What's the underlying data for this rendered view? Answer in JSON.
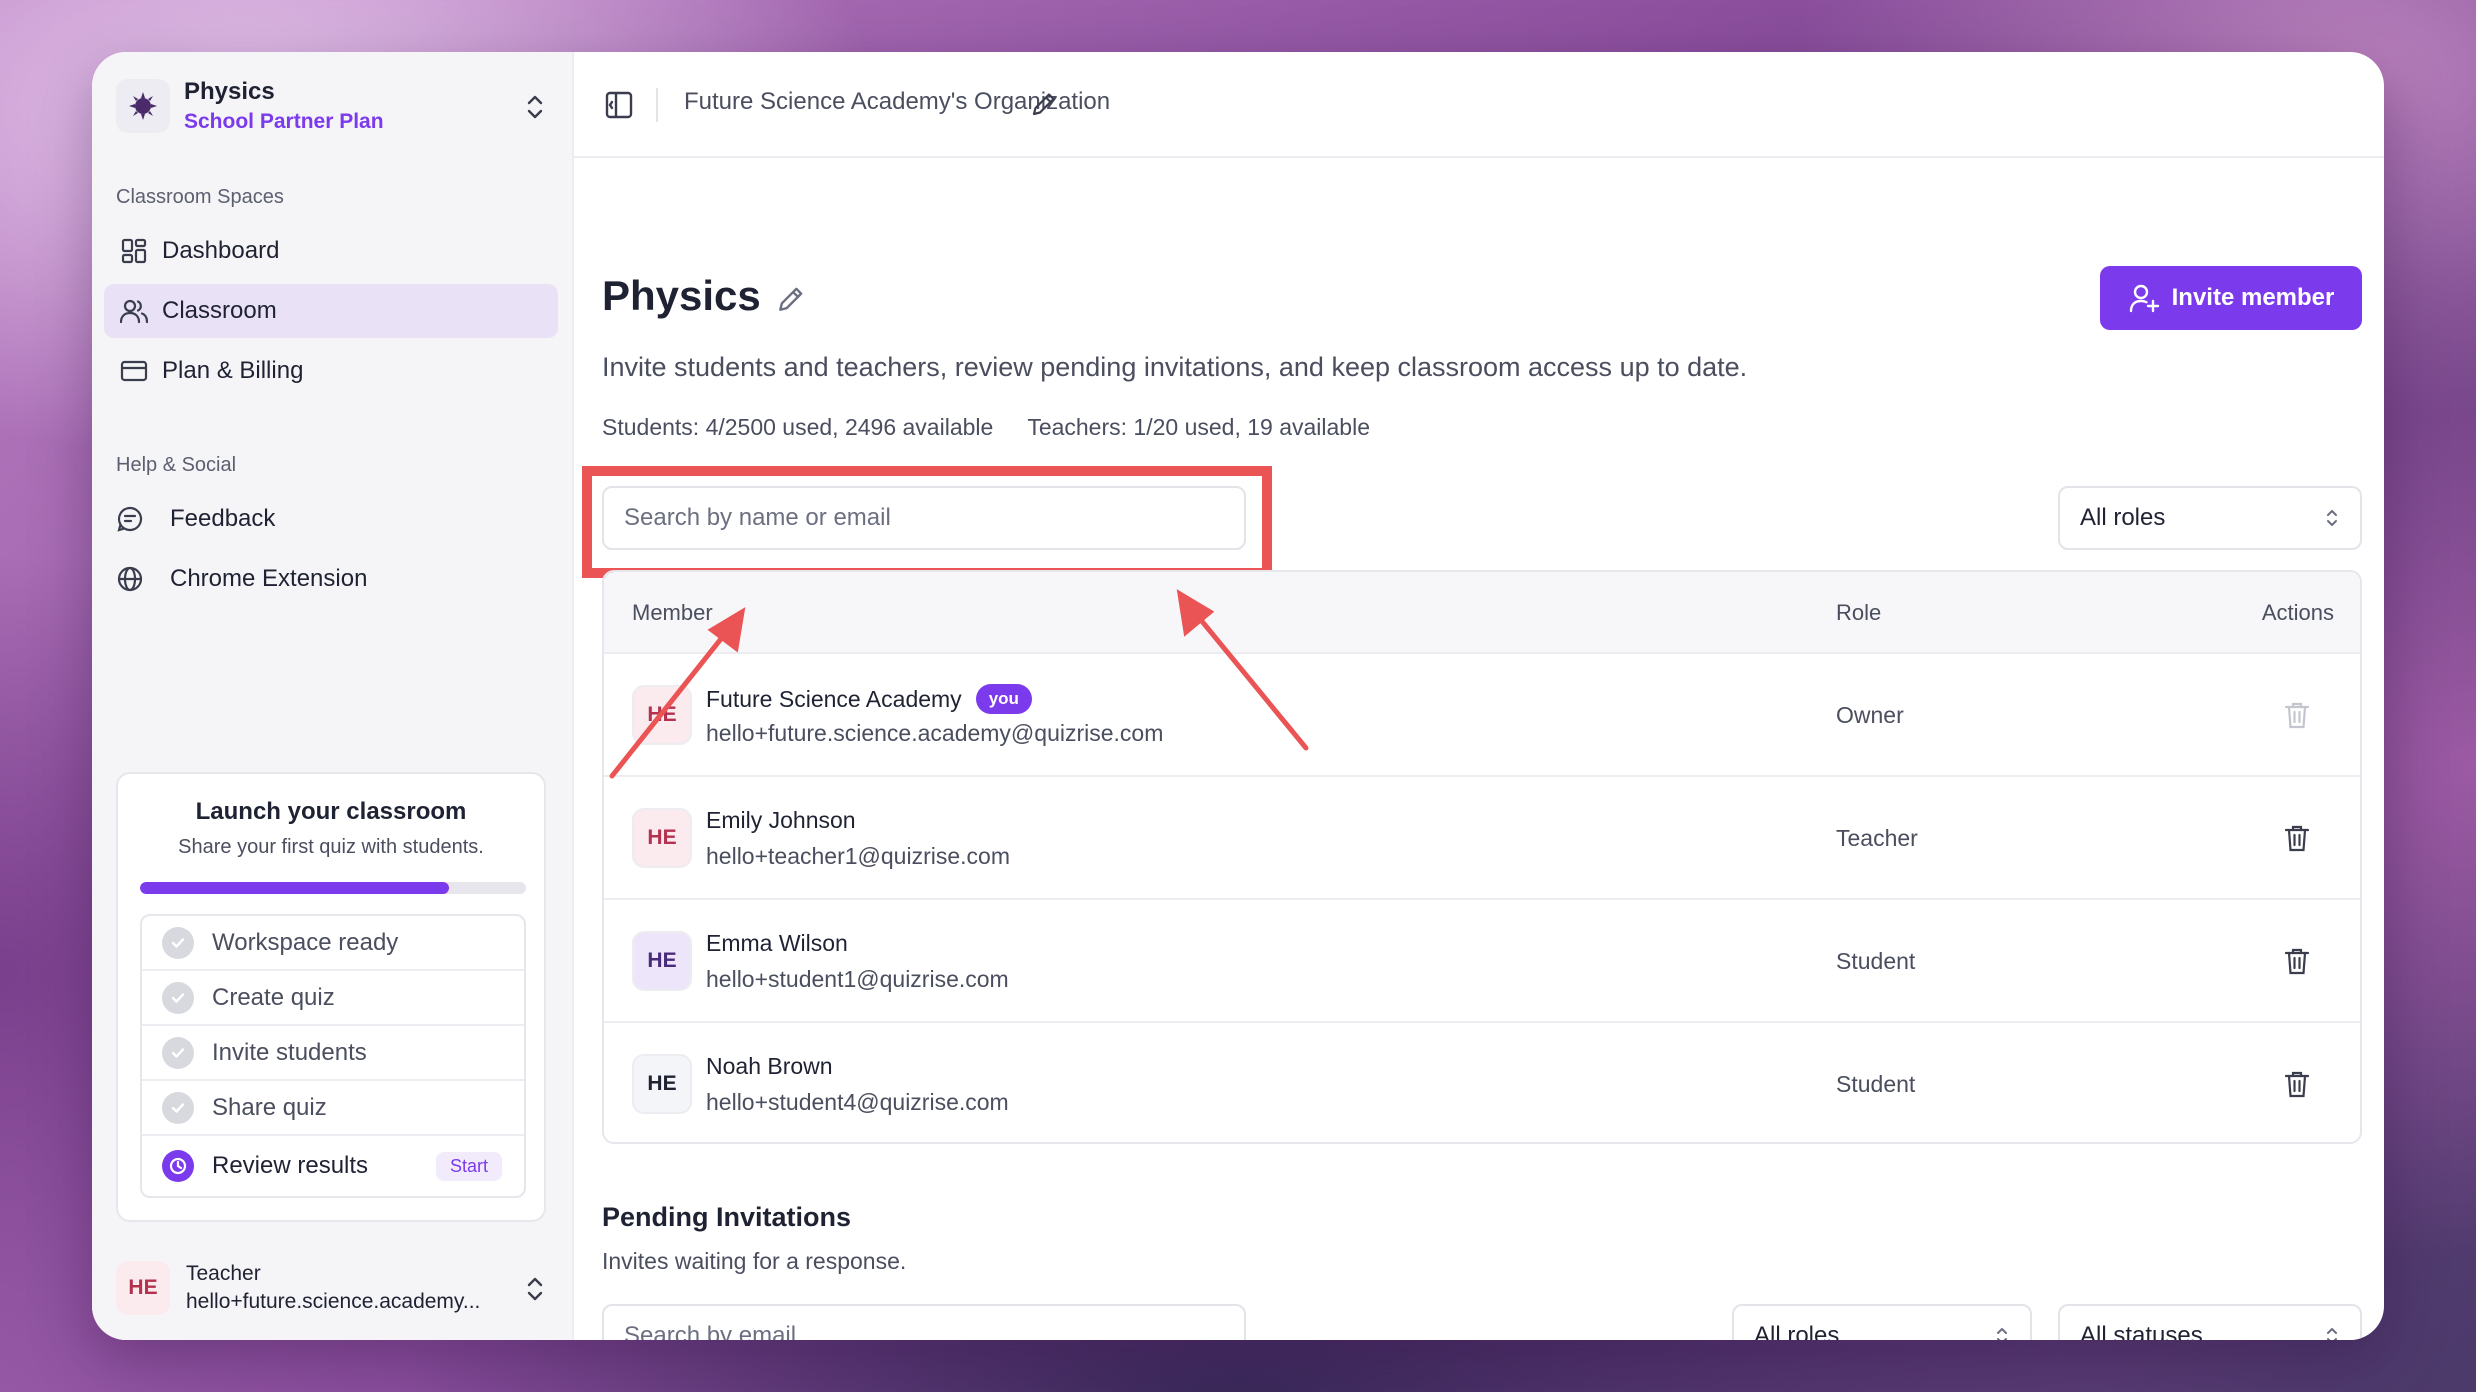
{
  "org": {
    "name": "Physics",
    "plan": "School Partner Plan"
  },
  "sidebar": {
    "section_classroom": "Classroom Spaces",
    "items": [
      {
        "label": "Dashboard"
      },
      {
        "label": "Classroom"
      },
      {
        "label": "Plan & Billing"
      }
    ],
    "section_help": "Help & Social",
    "help_items": [
      {
        "label": "Feedback"
      },
      {
        "label": "Chrome Extension"
      }
    ]
  },
  "launch": {
    "title": "Launch your classroom",
    "subtitle": "Share your first quiz with students.",
    "progress": 0.8,
    "steps": [
      {
        "label": "Workspace ready"
      },
      {
        "label": "Create quiz"
      },
      {
        "label": "Invite students"
      },
      {
        "label": "Share quiz"
      },
      {
        "label": "Review results",
        "action": "Start"
      }
    ]
  },
  "user": {
    "initials": "HE",
    "role": "Teacher",
    "email": "hello+future.science.academy..."
  },
  "topbar": {
    "org_title": "Future Science Academy's Organization"
  },
  "page": {
    "title": "Physics",
    "invite_label": "Invite member",
    "description": "Invite students and teachers, review pending invitations, and keep classroom access up to date.",
    "students_quota": "Students: 4/2500 used, 2496 available",
    "teachers_quota": "Teachers: 1/20 used, 19 available",
    "search_placeholder": "Search by name or email",
    "role_filter": "All roles"
  },
  "table": {
    "headers": {
      "member": "Member",
      "role": "Role",
      "actions": "Actions"
    },
    "rows": [
      {
        "initials": "HE",
        "name": "Future Science Academy",
        "badge": "you",
        "email": "hello+future.science.academy@quizrise.com",
        "role": "Owner"
      },
      {
        "initials": "HE",
        "name": "Emily Johnson",
        "email": "hello+teacher1@quizrise.com",
        "role": "Teacher"
      },
      {
        "initials": "HE",
        "name": "Emma Wilson",
        "email": "hello+student1@quizrise.com",
        "role": "Student"
      },
      {
        "initials": "HE",
        "name": "Noah Brown",
        "email": "hello+student4@quizrise.com",
        "role": "Student"
      }
    ]
  },
  "pending": {
    "title": "Pending Invitations",
    "subtitle": "Invites waiting for a response.",
    "search_placeholder": "Search by email",
    "role_filter": "All roles",
    "status_filter": "All statuses"
  },
  "colors": {
    "accent": "#7c3aed",
    "highlight": "#ea5455"
  }
}
